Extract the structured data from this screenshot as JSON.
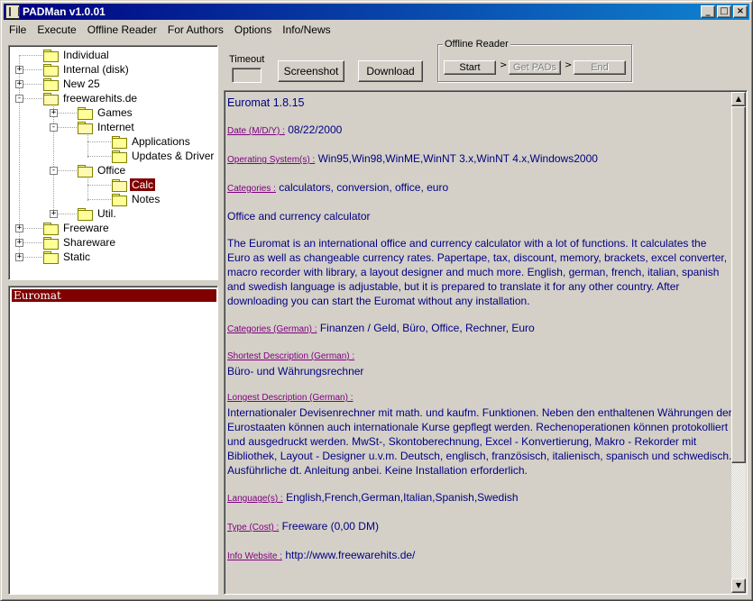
{
  "window": {
    "title": "PADMan v1.0.01"
  },
  "menu": [
    {
      "label": "File"
    },
    {
      "label": "Execute"
    },
    {
      "label": "Offline Reader"
    },
    {
      "label": "For Authors"
    },
    {
      "label": "Options"
    },
    {
      "label": "Info/News"
    }
  ],
  "tree": [
    {
      "label": "Individual",
      "expander": ""
    },
    {
      "label": "Internal (disk)",
      "expander": "+"
    },
    {
      "label": "New 25",
      "expander": "+"
    },
    {
      "label": "freewarehits.de",
      "expander": "-"
    },
    {
      "label": "Games",
      "expander": "+"
    },
    {
      "label": "Internet",
      "expander": "-"
    },
    {
      "label": "Applications",
      "expander": ""
    },
    {
      "label": "Updates & Driver",
      "expander": ""
    },
    {
      "label": "Office",
      "expander": "-"
    },
    {
      "label": "Calc",
      "expander": "",
      "selected": true
    },
    {
      "label": "Notes",
      "expander": ""
    },
    {
      "label": "Util.",
      "expander": "+"
    },
    {
      "label": "Freeware",
      "expander": "+"
    },
    {
      "label": "Shareware",
      "expander": "+"
    },
    {
      "label": "Static",
      "expander": "+"
    }
  ],
  "list": {
    "selected_item": "Euromat"
  },
  "toolbar": {
    "timeout_label": "Timeout",
    "screenshot_label": "Screenshot",
    "download_label": "Download"
  },
  "offline_reader": {
    "title": "Offline Reader",
    "start_label": "Start",
    "get_pads_label": "Get PADs",
    "end_label": "End"
  },
  "detail": {
    "title": "Euromat 1.8.15",
    "date_label": "Date (M/D/Y) :",
    "date_value": "08/22/2000",
    "os_label": "Operating System(s) :",
    "os_value": "Win95,Win98,WinME,WinNT 3.x,WinNT 4.x,Windows2000",
    "categories_label": "Categories :",
    "categories_value": "calculators, conversion, office, euro",
    "short_description": "Office and currency calculator",
    "long_description": "The Euromat is an international office and currency calculator with a lot of functions. It calculates the Euro as well as changeable currency rates. Papertape, tax, discount, memory, brackets, excel converter, macro recorder with library, a layout designer and much more. English, german, french, italian, spanish and swedish language is adjustable, but it is prepared to translate it for any other country. After downloading you can start the Euromat without any installation.",
    "categories_de_label": "Categories (German) :",
    "categories_de_value": "Finanzen / Geld, Büro, Office, Rechner, Euro",
    "short_de_label": "Shortest Description (German) :",
    "short_de_value": "Büro- und Währungsrechner",
    "long_de_label": "Longest Description (German) :",
    "long_de_value": "Internationaler Devisenrechner mit math. und kaufm. Funktionen. Neben den enthaltenen Währungen der Eurostaaten können auch internationale Kurse gepflegt werden. Rechenoperationen können protokolliert und ausgedruckt werden. MwSt-, Skontoberechnung, Excel - Konvertierung, Makro - Rekorder mit Bibliothek, Layout - Designer u.v.m. Deutsch, englisch, französisch, italienisch, spanisch und schwedisch. Ausführliche dt. Anleitung anbei. Keine Installation erforderlich.",
    "language_label": "Language(s) :",
    "language_value": "English,French,German,Italian,Spanish,Swedish",
    "type_label": "Type (Cost) :",
    "type_value": "Freeware (0,00 DM)",
    "website_label": "Info Website :",
    "website_value": "http://www.freewarehits.de/"
  },
  "colors": {
    "title_bar": "#000080",
    "selection": "#800000",
    "content_text": "#000080",
    "field_label": "#800080"
  }
}
